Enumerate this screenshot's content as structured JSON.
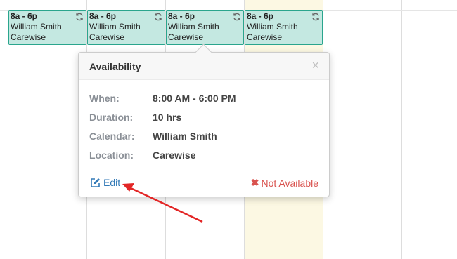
{
  "colors": {
    "event_bg": "#c4e8e1",
    "event_border": "#2aa58d",
    "today_bg": "#fcf8e3",
    "link_blue": "#337ab7",
    "danger_red": "#d9534f",
    "annotation_red": "#e32626"
  },
  "events": [
    {
      "time": "8a - 6p",
      "name": "William Smith",
      "location": "Carewise",
      "icon": "recurring-icon"
    },
    {
      "time": "8a - 6p",
      "name": "William Smith",
      "location": "Carewise",
      "icon": "recurring-icon"
    },
    {
      "time": "8a - 6p",
      "name": "William Smith",
      "location": "Carewise",
      "icon": "recurring-icon"
    },
    {
      "time": "8a - 6p",
      "name": "William Smith",
      "location": "Carewise",
      "icon": "recurring-icon"
    }
  ],
  "popover": {
    "title": "Availability",
    "close_icon": "close-icon",
    "fields": {
      "when": {
        "label": "When:",
        "value": "8:00 AM - 6:00 PM"
      },
      "duration": {
        "label": "Duration:",
        "value": "10 hrs"
      },
      "calendar": {
        "label": "Calendar:",
        "value": "William Smith"
      },
      "location": {
        "label": "Location:",
        "value": "Carewise"
      }
    },
    "edit_label": "Edit",
    "not_available_label": "Not Available"
  }
}
